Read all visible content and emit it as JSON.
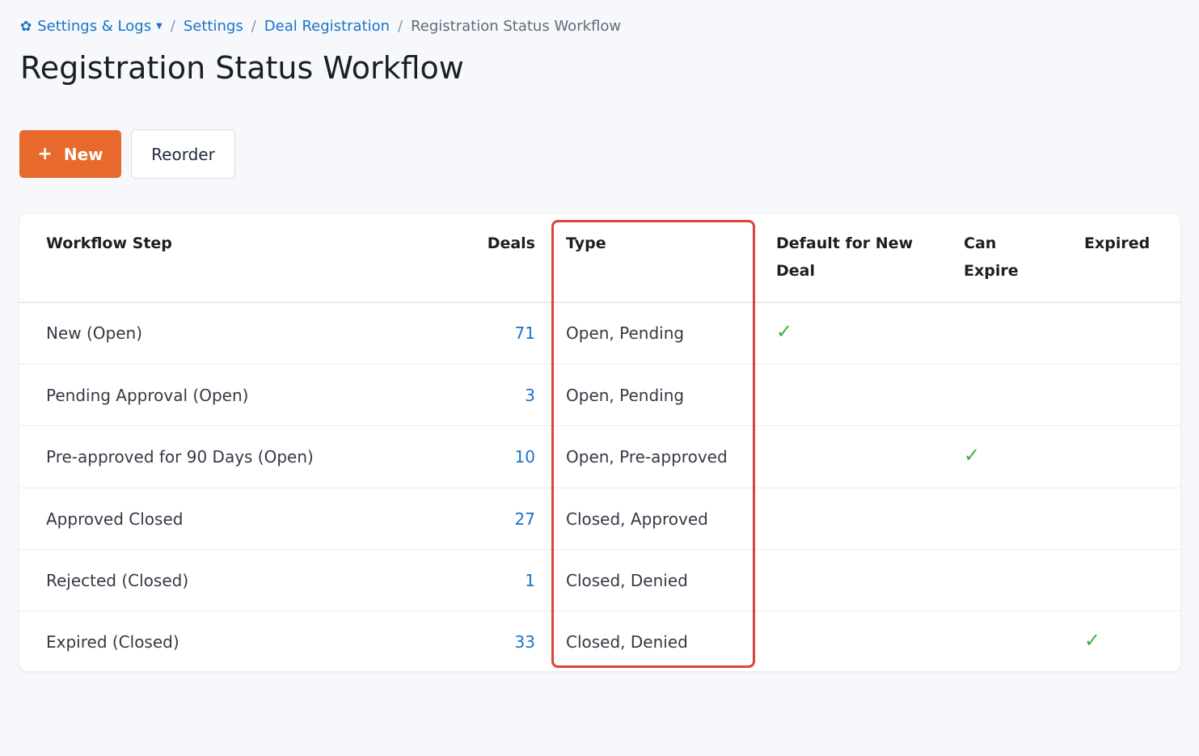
{
  "breadcrumb": {
    "root": "Settings & Logs",
    "items": [
      "Settings",
      "Deal Registration"
    ],
    "current": "Registration Status Workflow"
  },
  "page": {
    "title": "Registration Status Workflow"
  },
  "toolbar": {
    "new_label": "New",
    "reorder_label": "Reorder"
  },
  "table": {
    "columns": {
      "step": "Workflow Step",
      "deals": "Deals",
      "type": "Type",
      "default": "Default for New Deal",
      "can_expire": "Can Expire",
      "expired": "Expired"
    },
    "check_glyph": "✓",
    "rows": [
      {
        "step": "New (Open)",
        "deals": "71",
        "type": "Open, Pending",
        "default_for_new_deal": true,
        "can_expire": false,
        "expired": false
      },
      {
        "step": "Pending Approval (Open)",
        "deals": "3",
        "type": "Open, Pending",
        "default_for_new_deal": false,
        "can_expire": false,
        "expired": false
      },
      {
        "step": "Pre-approved for 90 Days (Open)",
        "deals": "10",
        "type": "Open, Pre-approved",
        "default_for_new_deal": false,
        "can_expire": true,
        "expired": false
      },
      {
        "step": "Approved Closed",
        "deals": "27",
        "type": "Closed, Approved",
        "default_for_new_deal": false,
        "can_expire": false,
        "expired": false
      },
      {
        "step": "Rejected (Closed)",
        "deals": "1",
        "type": "Closed, Denied",
        "default_for_new_deal": false,
        "can_expire": false,
        "expired": false
      },
      {
        "step": "Expired (Closed)",
        "deals": "33",
        "type": "Closed, Denied",
        "default_for_new_deal": false,
        "can_expire": false,
        "expired": true
      }
    ]
  },
  "colors": {
    "accent": "#e8692c",
    "link": "#1a73c8",
    "check": "#3cb043",
    "highlight": "#d9453c"
  }
}
